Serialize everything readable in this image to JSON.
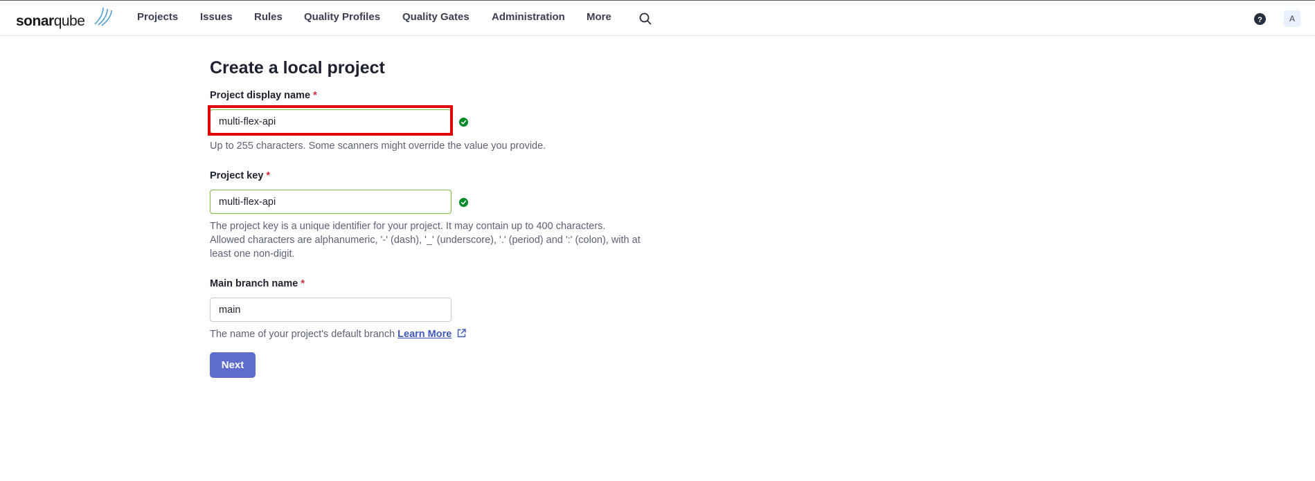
{
  "brand": {
    "sonar": "sonar",
    "qube": "qube"
  },
  "nav": {
    "items": [
      {
        "label": "Projects"
      },
      {
        "label": "Issues"
      },
      {
        "label": "Rules"
      },
      {
        "label": "Quality Profiles"
      },
      {
        "label": "Quality Gates"
      },
      {
        "label": "Administration"
      },
      {
        "label": "More"
      }
    ],
    "search_icon": "search-icon",
    "help_icon": "question-circle-icon",
    "avatar_letter": "A"
  },
  "page": {
    "title": "Create a local project",
    "required_marker": "*",
    "display_name": {
      "label": "Project display name",
      "value": "multi-flex-api",
      "help": "Up to 255 characters. Some scanners might override the value you provide."
    },
    "project_key": {
      "label": "Project key",
      "value": "multi-flex-api",
      "help_lines": [
        "The project key is a unique identifier for your project. It may contain up to 400 characters.",
        "Allowed characters are alphanumeric, '-' (dash), '_' (underscore), '.' (period) and ':' (colon), with at",
        "least one non-digit."
      ]
    },
    "main_branch": {
      "label": "Main branch name",
      "value": "main",
      "help": "The name of your project's default branch",
      "learn_more": "Learn More"
    },
    "next_label": "Next"
  },
  "colors": {
    "primary": "#5d6ccd",
    "valid": "#008a25",
    "required": "#d02f3a",
    "highlight": "#e00000"
  }
}
